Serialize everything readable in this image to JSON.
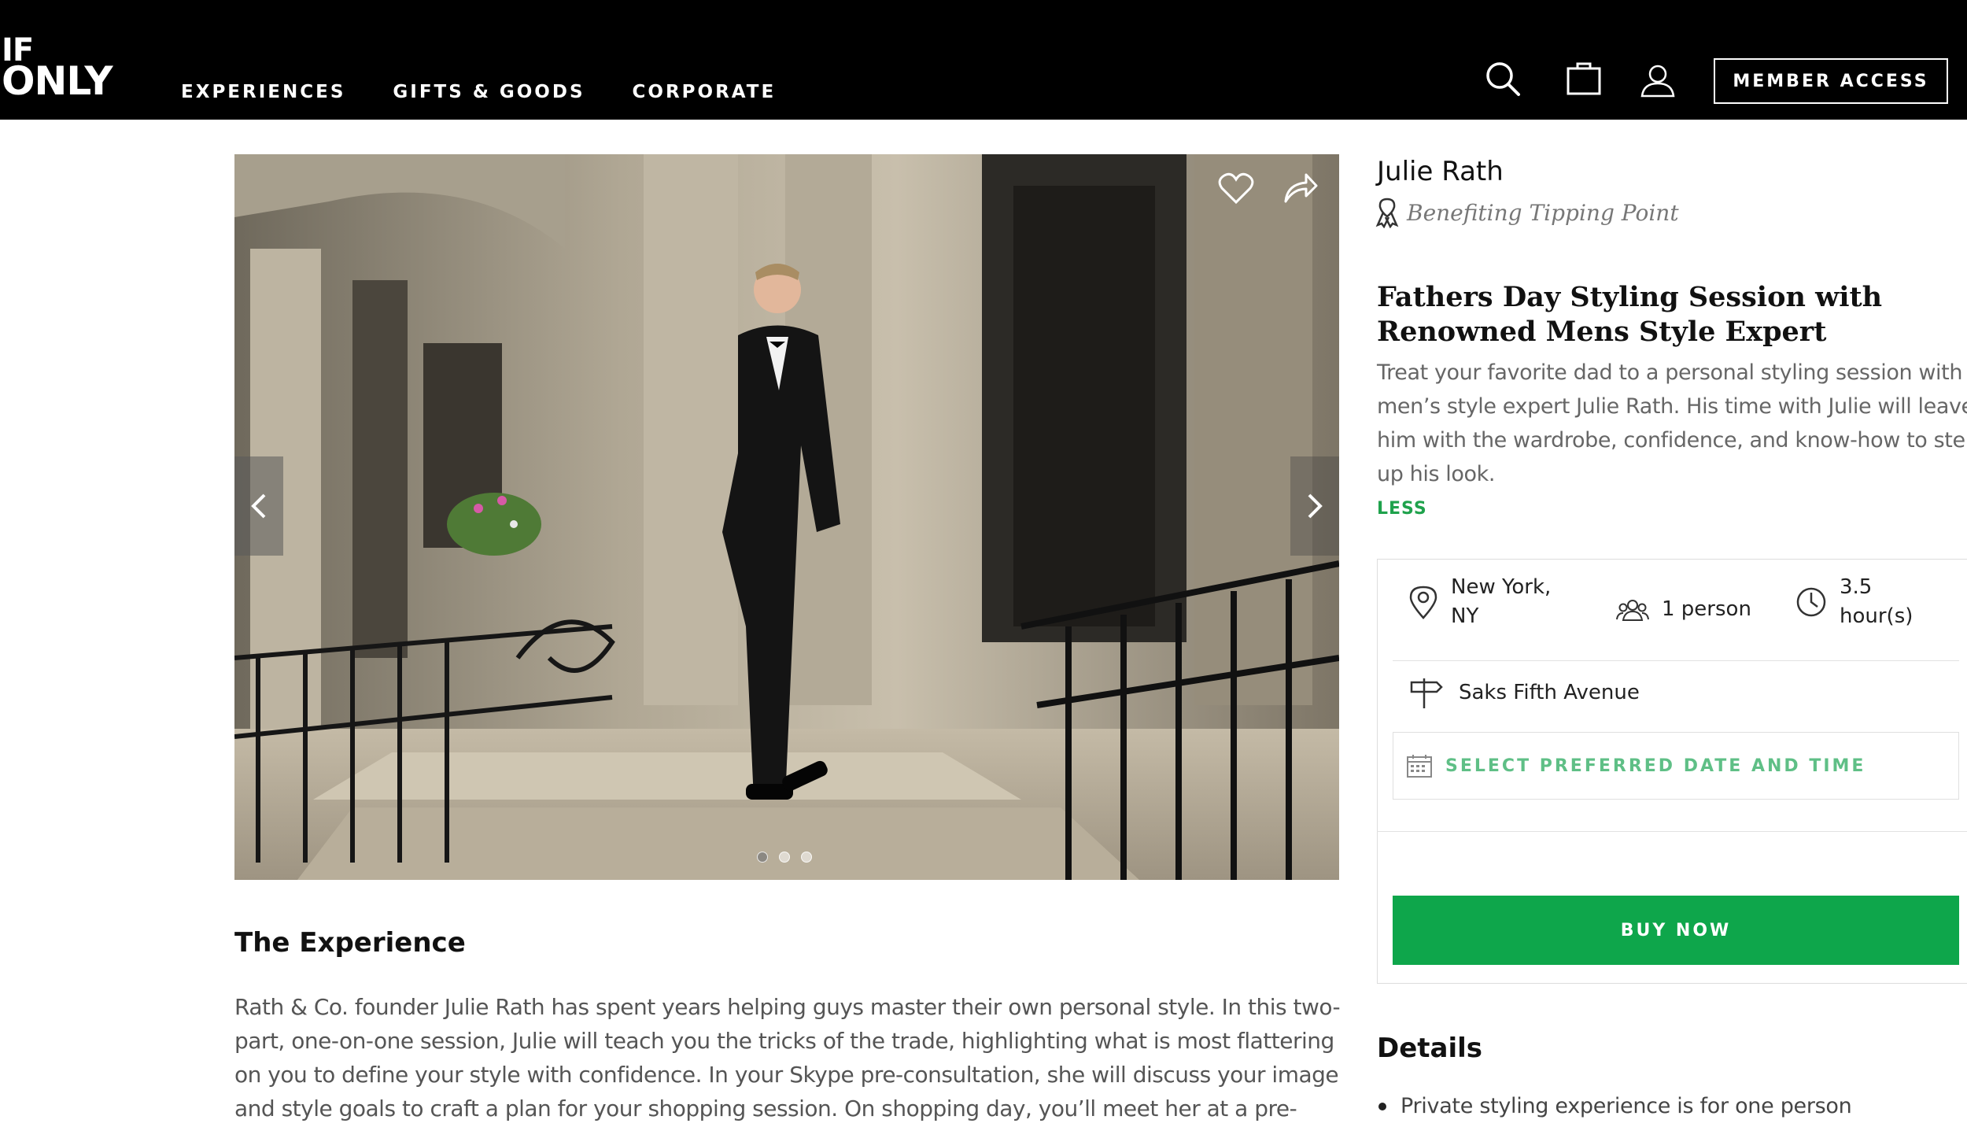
{
  "brand": {
    "logo_line1": "IF",
    "logo_line2": "ONLY"
  },
  "nav": {
    "items": [
      "EXPERIENCES",
      "GIFTS & GOODS",
      "CORPORATE"
    ]
  },
  "header": {
    "icons": [
      "search-icon",
      "shopping-bag-icon",
      "user-icon"
    ],
    "member_access": "MEMBER ACCESS"
  },
  "gallery": {
    "image_count": 3,
    "active_index": 0,
    "icons": [
      "heart-icon",
      "share-icon",
      "chevron-left-icon",
      "chevron-right-icon"
    ]
  },
  "experience": {
    "host": "Julie Rath",
    "charity": "Benefiting Tipping Point",
    "title": "Fathers Day Styling Session with Renowned Mens Style Expert",
    "description": "Treat your favorite dad to a personal styling session with men’s style expert Julie Rath. His time with Julie will leave him with the wardrobe, confidence, and know-how to step up his look.",
    "less_label": "LESS",
    "location": "New York, NY",
    "guests": "1 person",
    "duration": "3.5 hour(s)",
    "venue": "Saks Fifth Avenue",
    "date_placeholder": "SELECT PREFERRED DATE AND TIME",
    "buy_label": "BUY NOW"
  },
  "about": {
    "heading": "The Experience",
    "body": "Rath & Co. founder Julie Rath has spent years helping guys master their own personal style. In this two-part, one-on-one session, Julie will teach you the tricks of the trade, highlighting what is most flattering on you to define your style with confidence. In your Skype pre-consultation, she will discuss your image and style goals to craft a plan for your shopping session. On shopping day, you’ll meet her at a pre-arranged location, and be escorted to"
  },
  "details": {
    "heading": "Details",
    "items": [
      "Private styling experience is for one person"
    ]
  },
  "colors": {
    "accent_green": "#0ea64b",
    "link_green": "#1fa24c",
    "header_bg": "#000000"
  }
}
